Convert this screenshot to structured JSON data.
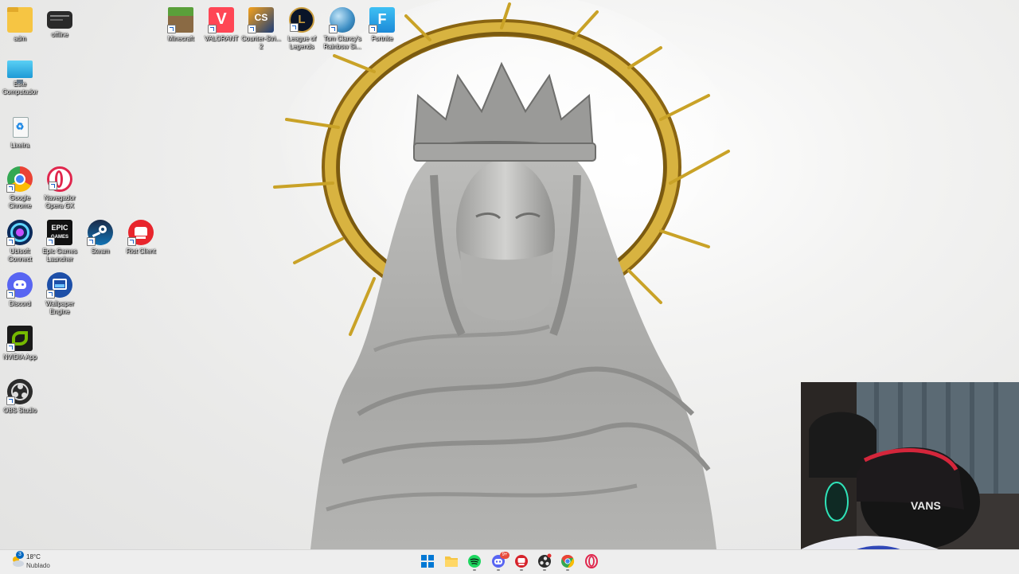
{
  "desktop": {
    "icons": [
      {
        "label": "adm"
      },
      {
        "label": "offline"
      },
      {
        "label": "Este Computador"
      },
      {
        "label": "Lixeira"
      },
      {
        "label": "Google Chrome"
      },
      {
        "label": "Navegador Opera GX"
      },
      {
        "label": "Ubisoft Connect"
      },
      {
        "label": "Epic Games Launcher"
      },
      {
        "label": "Steam"
      },
      {
        "label": "Riot Client"
      },
      {
        "label": "Discord"
      },
      {
        "label": "Wallpaper Engine"
      },
      {
        "label": "NVIDIA App"
      },
      {
        "label": "OBS Studio"
      },
      {
        "label": "Minecraft"
      },
      {
        "label": "VALORANT"
      },
      {
        "label": "Counter-Stri... 2"
      },
      {
        "label": "League of Legends"
      },
      {
        "label": "Tom Clancy's Rainbow Si..."
      },
      {
        "label": "Fortnite"
      }
    ]
  },
  "taskbar": {
    "weather": {
      "temp": "18°C",
      "condition": "Nublado",
      "icon": "cloud-sun-icon",
      "badge": "3"
    },
    "apps": [
      {
        "name": "start-button",
        "icon": "windows-logo-icon"
      },
      {
        "name": "file-explorer",
        "icon": "folder-icon"
      },
      {
        "name": "spotify",
        "icon": "spotify-icon"
      },
      {
        "name": "discord",
        "icon": "discord-icon",
        "badge": "9+"
      },
      {
        "name": "riot-client",
        "icon": "riot-icon"
      },
      {
        "name": "obs-studio",
        "icon": "obs-icon"
      },
      {
        "name": "google-chrome",
        "icon": "chrome-icon"
      },
      {
        "name": "opera-gx",
        "icon": "opera-icon"
      }
    ]
  },
  "webcam": {
    "cap_text": "VANS"
  },
  "colors": {
    "taskbar": "#eeeeee",
    "gold": "#c9a227",
    "accent": "#0067c0"
  }
}
